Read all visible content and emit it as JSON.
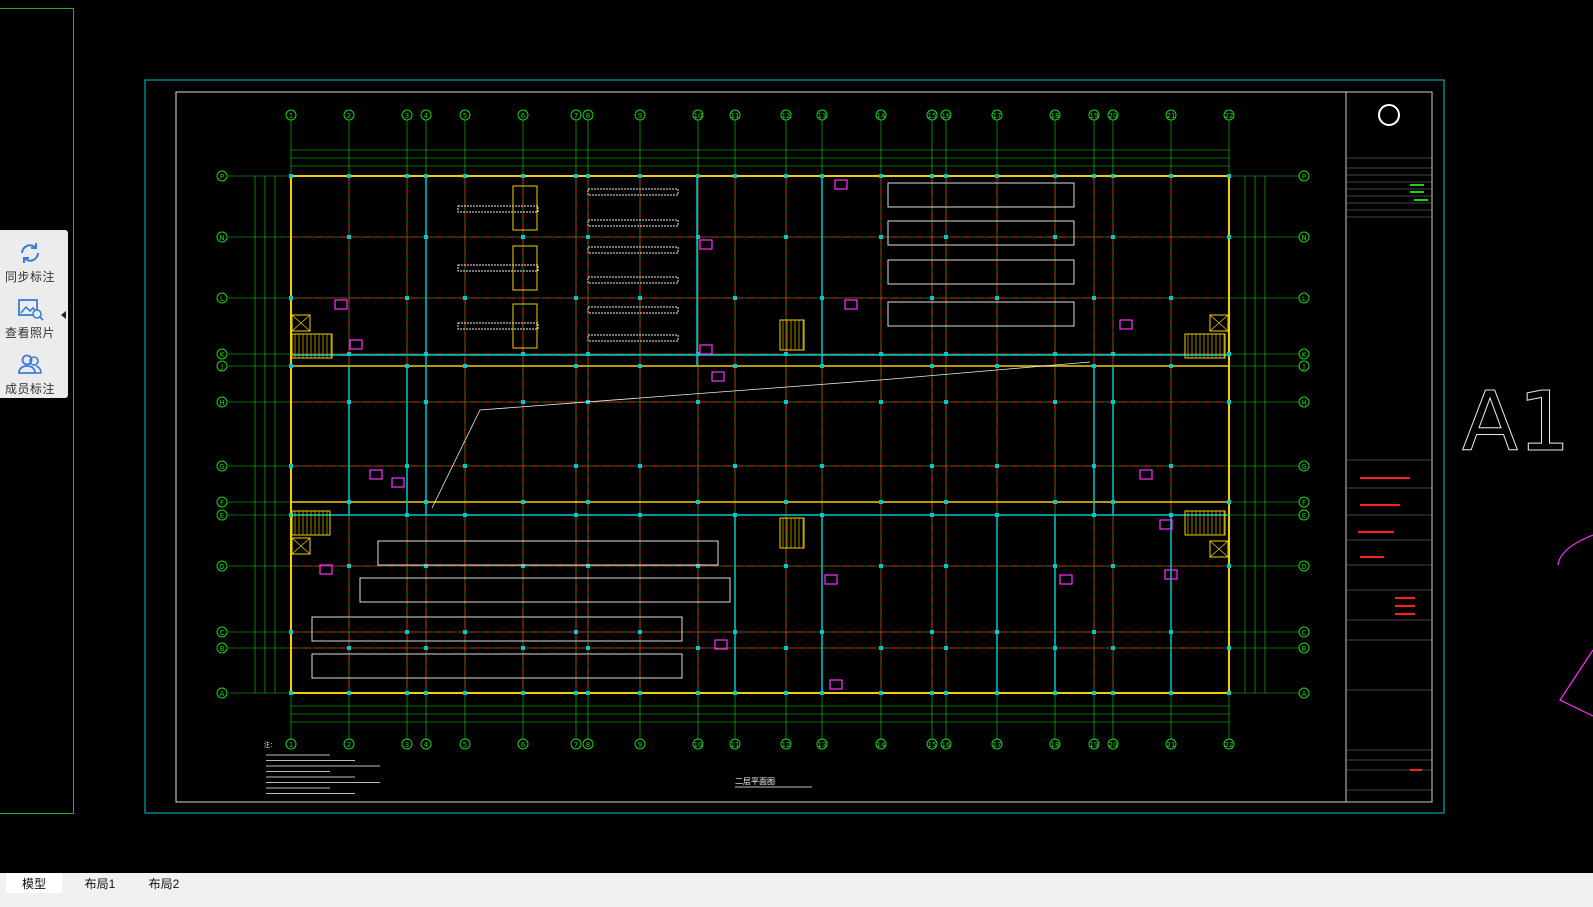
{
  "toolbar": {
    "items": [
      {
        "label": "同步标注",
        "icon": "sync-icon"
      },
      {
        "label": "查看照片",
        "icon": "photo-view-icon"
      },
      {
        "label": "成员标注",
        "icon": "members-icon"
      }
    ],
    "collapse_icon": "triangle-left-icon"
  },
  "drawing": {
    "sheet_size_label": "A1",
    "plan_title": "二层平面图",
    "notes_heading": "注：",
    "grid_columns": [
      "1",
      "2",
      "3",
      "4",
      "5",
      "6",
      "7",
      "8",
      "9",
      "10",
      "11",
      "12",
      "13",
      "14",
      "15",
      "16",
      "17",
      "18",
      "19",
      "20",
      "21",
      "22"
    ],
    "grid_rows": [
      "P",
      "N",
      "L",
      "K",
      "J",
      "H",
      "G",
      "F",
      "E",
      "D",
      "C",
      "B",
      "A"
    ]
  },
  "tabs": [
    {
      "label": "模型",
      "active": true
    },
    {
      "label": "布局1",
      "active": false
    },
    {
      "label": "布局2",
      "active": false
    }
  ],
  "colors": {
    "background": "#000000",
    "frame_cyan": "#00c8c8",
    "grid_green": "#19d219",
    "axis_red": "#ff2020",
    "wall_yellow": "#f0d000",
    "accent_magenta": "#ff30ff"
  }
}
